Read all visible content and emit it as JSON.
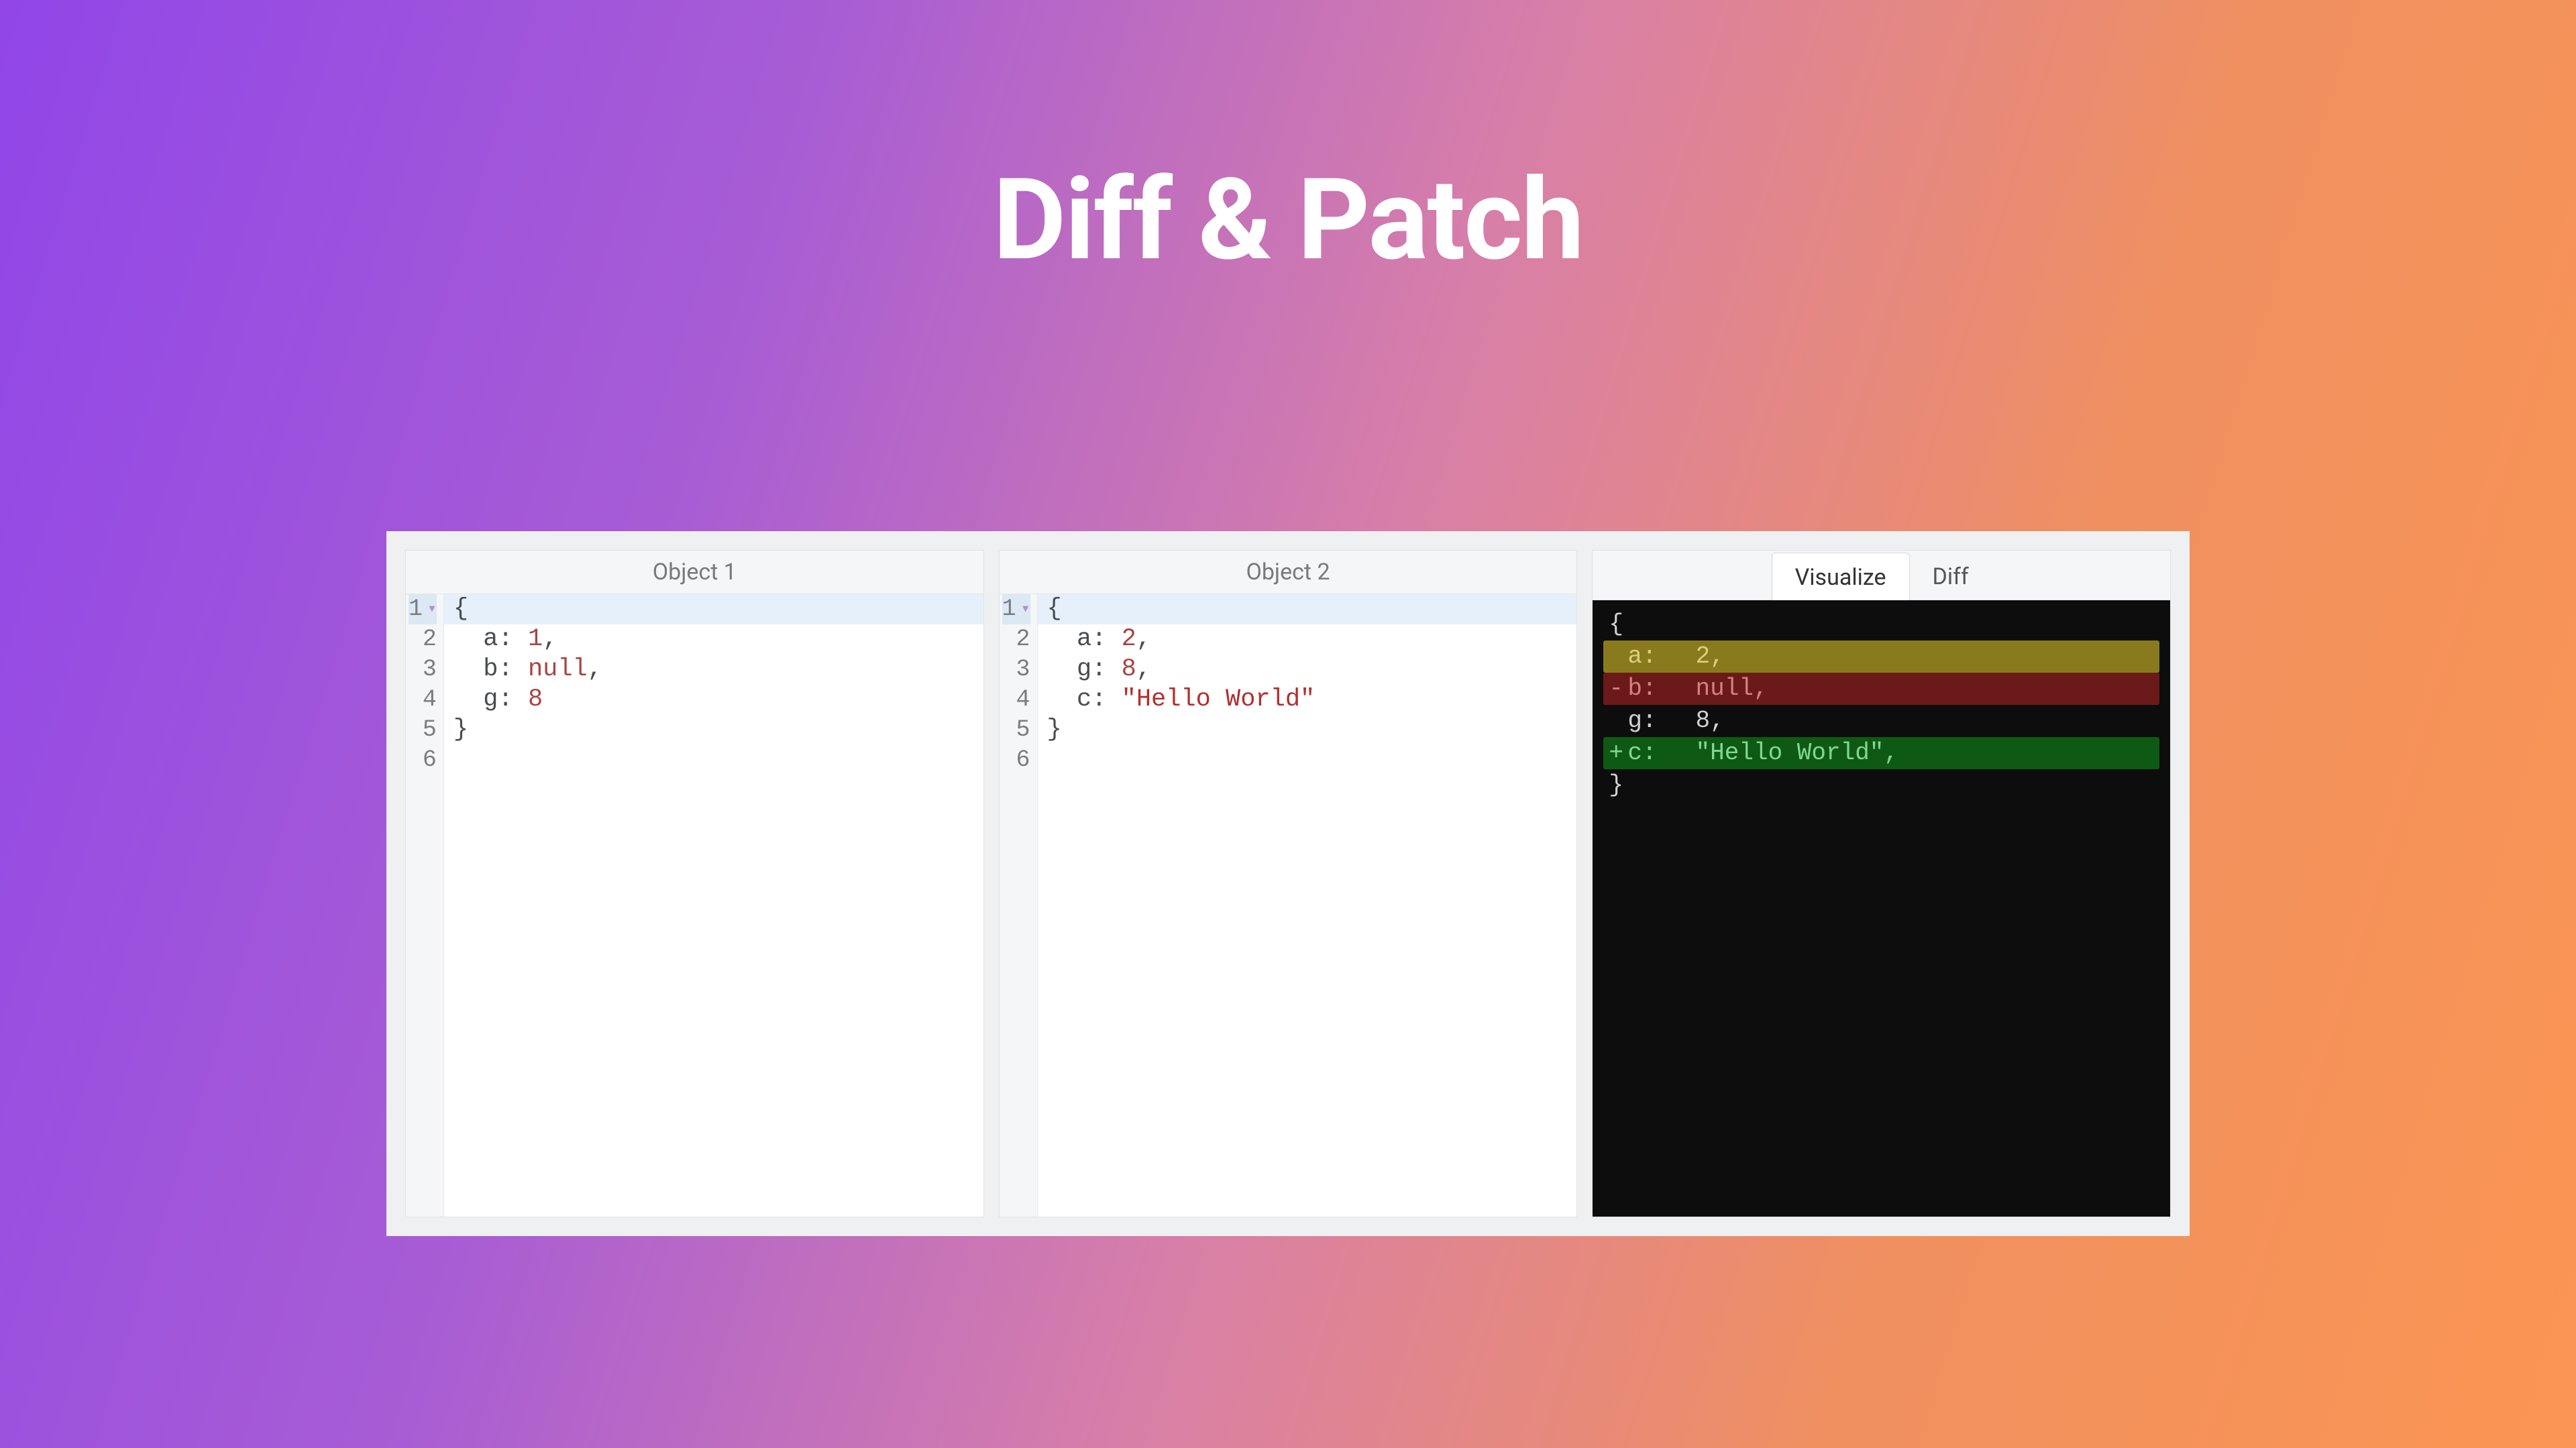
{
  "title": "Diff & Patch",
  "editors": {
    "object1": {
      "header": "Object 1",
      "lines": [
        {
          "num": "1",
          "fold": true,
          "active": true,
          "tokens": [
            {
              "t": "punc",
              "v": "{"
            }
          ]
        },
        {
          "num": "2",
          "tokens": [
            {
              "t": "indent",
              "v": "  "
            },
            {
              "t": "key",
              "v": "a"
            },
            {
              "t": "punc",
              "v": ": "
            },
            {
              "t": "num",
              "v": "1"
            },
            {
              "t": "punc",
              "v": ","
            }
          ]
        },
        {
          "num": "3",
          "tokens": [
            {
              "t": "indent",
              "v": "  "
            },
            {
              "t": "key",
              "v": "b"
            },
            {
              "t": "punc",
              "v": ": "
            },
            {
              "t": "null",
              "v": "null"
            },
            {
              "t": "punc",
              "v": ","
            }
          ]
        },
        {
          "num": "4",
          "tokens": [
            {
              "t": "indent",
              "v": "  "
            },
            {
              "t": "key",
              "v": "g"
            },
            {
              "t": "punc",
              "v": ": "
            },
            {
              "t": "num",
              "v": "8"
            }
          ]
        },
        {
          "num": "5",
          "tokens": [
            {
              "t": "punc",
              "v": "}"
            }
          ]
        },
        {
          "num": "6",
          "tokens": []
        }
      ]
    },
    "object2": {
      "header": "Object 2",
      "lines": [
        {
          "num": "1",
          "fold": true,
          "active": true,
          "tokens": [
            {
              "t": "punc",
              "v": "{"
            }
          ]
        },
        {
          "num": "2",
          "tokens": [
            {
              "t": "indent",
              "v": "  "
            },
            {
              "t": "key",
              "v": "a"
            },
            {
              "t": "punc",
              "v": ": "
            },
            {
              "t": "num",
              "v": "2"
            },
            {
              "t": "punc",
              "v": ","
            }
          ]
        },
        {
          "num": "3",
          "tokens": [
            {
              "t": "indent",
              "v": "  "
            },
            {
              "t": "key",
              "v": "g"
            },
            {
              "t": "punc",
              "v": ": "
            },
            {
              "t": "num",
              "v": "8"
            },
            {
              "t": "punc",
              "v": ","
            }
          ]
        },
        {
          "num": "4",
          "tokens": [
            {
              "t": "indent",
              "v": "  "
            },
            {
              "t": "key",
              "v": "c"
            },
            {
              "t": "punc",
              "v": ": "
            },
            {
              "t": "str",
              "v": "\"Hello World\""
            }
          ]
        },
        {
          "num": "5",
          "tokens": [
            {
              "t": "punc",
              "v": "}"
            }
          ]
        },
        {
          "num": "6",
          "tokens": []
        }
      ]
    }
  },
  "diff": {
    "tabs": {
      "visualize": "Visualize",
      "diff": "Diff"
    },
    "lines": [
      {
        "kind": "context",
        "prefix": "",
        "key": "",
        "val": "{"
      },
      {
        "kind": "modified",
        "prefix": "",
        "key": "a:",
        "val": "  2,"
      },
      {
        "kind": "removed",
        "prefix": "-",
        "key": "b:",
        "val": "  null,"
      },
      {
        "kind": "context",
        "prefix": "",
        "key": "g:",
        "val": "  8,"
      },
      {
        "kind": "added",
        "prefix": "+",
        "key": "c:",
        "val": "  \"Hello World\","
      },
      {
        "kind": "context",
        "prefix": "",
        "key": "",
        "val": "}"
      }
    ]
  }
}
